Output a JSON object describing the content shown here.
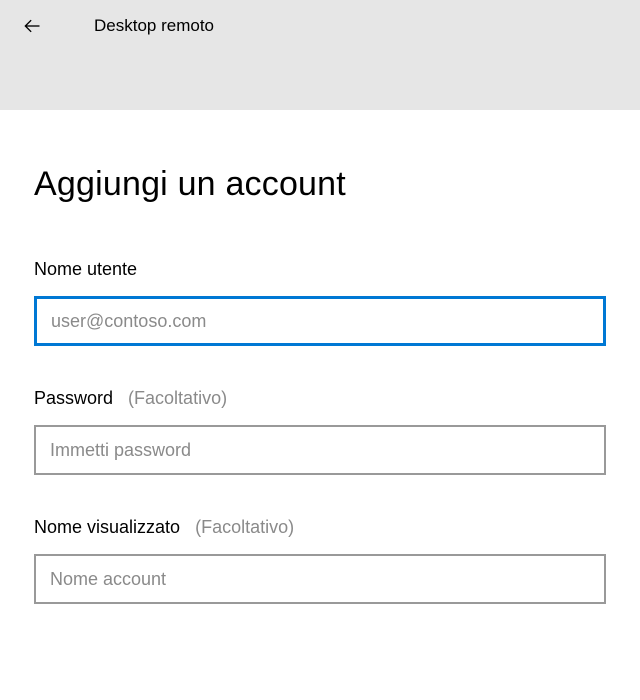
{
  "header": {
    "app_title": "Desktop remoto"
  },
  "page": {
    "title": "Aggiungi un account"
  },
  "fields": {
    "username": {
      "label": "Nome utente",
      "placeholder": "user@contoso.com",
      "value": ""
    },
    "password": {
      "label": "Password",
      "hint": "(Facoltativo)",
      "placeholder": "Immetti password",
      "value": ""
    },
    "display_name": {
      "label": "Nome visualizzato",
      "hint": "(Facoltativo)",
      "placeholder": "Nome account",
      "value": ""
    }
  }
}
